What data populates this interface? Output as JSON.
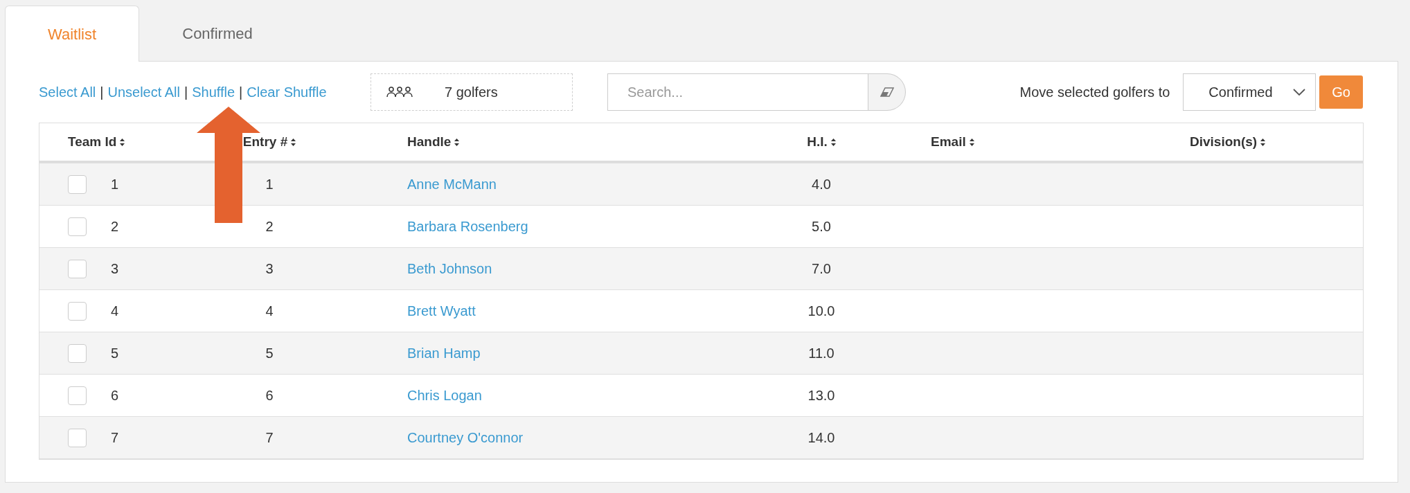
{
  "tabs": [
    {
      "label": "Waitlist",
      "selected": true
    },
    {
      "label": "Confirmed",
      "selected": false
    }
  ],
  "toolbar": {
    "links": [
      {
        "label": "Select All"
      },
      {
        "label": "Unselect All",
        "separator": "|"
      },
      {
        "label": "Shuffle",
        "separator": "|"
      },
      {
        "label": "Clear Shuffle",
        "separator": "|"
      }
    ],
    "golfer_count": "7 golfers",
    "search": {
      "placeholder": "Search..."
    },
    "move": {
      "label": "Move selected golfers to",
      "select_value": "Confirmed",
      "button": "Go"
    }
  },
  "table": {
    "columns": [
      "Team Id",
      "Entry #",
      "Handle",
      "H.I.",
      "Email",
      "Division(s)"
    ],
    "rows": [
      {
        "checked": false,
        "team_id": "1",
        "entry": "1",
        "handle": "Anne McMann",
        "hi": "4.0"
      },
      {
        "checked": false,
        "team_id": "2",
        "entry": "2",
        "handle": "Barbara Rosenberg",
        "hi": "5.0"
      },
      {
        "checked": false,
        "team_id": "3",
        "entry": "3",
        "handle": "Beth Johnson",
        "hi": "7.0"
      },
      {
        "checked": false,
        "team_id": "4",
        "entry": "4",
        "handle": "Brett Wyatt",
        "hi": "10.0"
      },
      {
        "checked": false,
        "team_id": "5",
        "entry": "5",
        "handle": "Brian Hamp",
        "hi": "11.0"
      },
      {
        "checked": false,
        "team_id": "6",
        "entry": "6",
        "handle": "Chris Logan",
        "hi": "13.0"
      },
      {
        "checked": false,
        "team_id": "7",
        "entry": "7",
        "handle": "Courtney O'connor",
        "hi": "14.0"
      }
    ]
  }
}
